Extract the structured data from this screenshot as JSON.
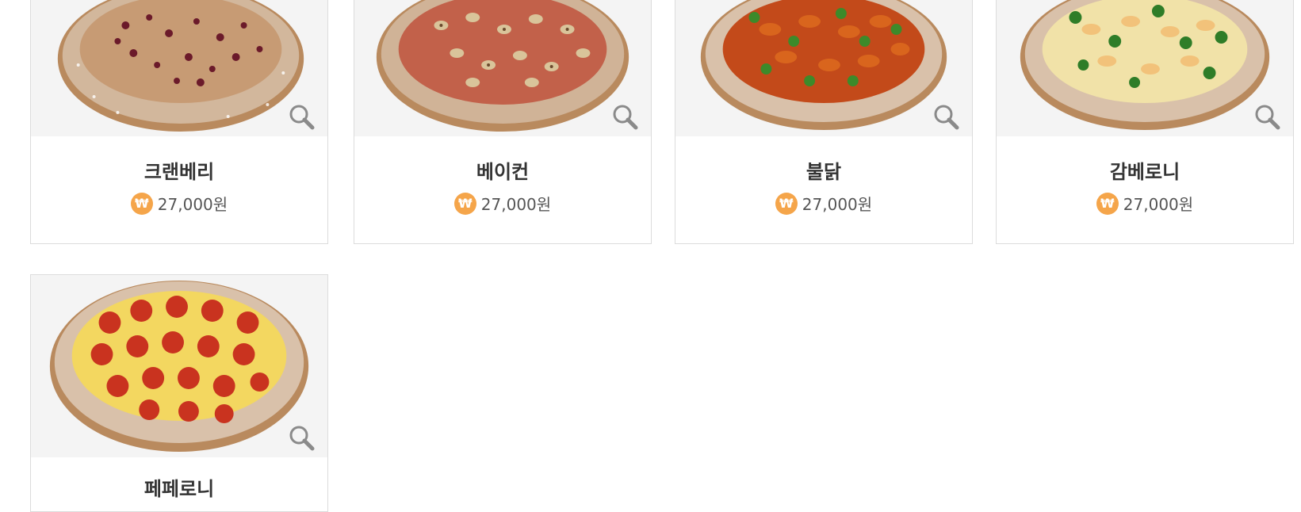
{
  "products": [
    {
      "name": "크랜베리",
      "price": "27,000원",
      "topping_color": "#6b1a2a",
      "accent_color": "#e9d9c0",
      "sauce_color": "#c79b74"
    },
    {
      "name": "베이컨",
      "price": "27,000원",
      "topping_color": "#b0502f",
      "accent_color": "#d9c49a",
      "sauce_color": "#c2614a"
    },
    {
      "name": "불닭",
      "price": "27,000원",
      "topping_color": "#d9651d",
      "accent_color": "#3d8a2a",
      "sauce_color": "#c34a1a"
    },
    {
      "name": "감베로니",
      "price": "27,000원",
      "topping_color": "#f2c27a",
      "accent_color": "#2f7d28",
      "sauce_color": "#f1e2a8"
    },
    {
      "name": "페페로니",
      "price": "",
      "topping_color": "#c9331f",
      "accent_color": "#f1c646",
      "sauce_color": "#f3d760"
    }
  ],
  "icons": {
    "currency": "won-coin-icon",
    "zoom": "magnifier-icon"
  },
  "colors": {
    "card_border": "#dcdcdc",
    "image_bg": "#f4f4f4",
    "coin": "#f5a54a",
    "crust": "#b98a5e"
  }
}
